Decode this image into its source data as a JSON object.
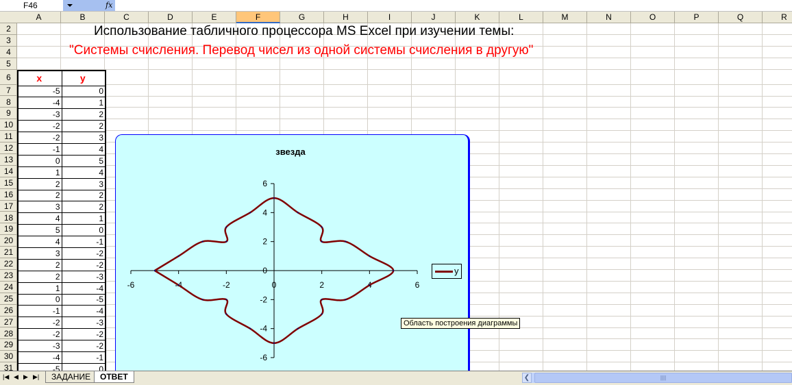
{
  "formula_bar": {
    "name_box": "F46",
    "fx_icon": "fx"
  },
  "columns": [
    "A",
    "B",
    "C",
    "D",
    "E",
    "F",
    "G",
    "H",
    "I",
    "J",
    "K",
    "L",
    "M",
    "N",
    "O",
    "P",
    "Q",
    "R"
  ],
  "selected_column": "F",
  "rows": [
    "2",
    "3",
    "4",
    "5",
    "6",
    "7",
    "8",
    "9",
    "10",
    "11",
    "12",
    "13",
    "14",
    "15",
    "16",
    "17",
    "18",
    "19",
    "20",
    "21",
    "22",
    "23",
    "24",
    "25",
    "26",
    "27",
    "28",
    "29",
    "30",
    "31"
  ],
  "heading_line1": "Использование табличного процессора MS Excel при изучении темы:",
  "heading_line2": "\"Системы счисления. Перевод чисел из одной системы счисления в другую\"",
  "heading_line2_color": "#ff0000",
  "table": {
    "headers": [
      "x",
      "y"
    ],
    "x": [
      -5,
      -4,
      -3,
      -2,
      -2,
      -1,
      0,
      1,
      2,
      2,
      3,
      4,
      5,
      4,
      3,
      2,
      2,
      1,
      0,
      -1,
      -2,
      -2,
      -3,
      -4,
      -5
    ],
    "y": [
      0,
      1,
      2,
      2,
      3,
      4,
      5,
      4,
      3,
      2,
      2,
      1,
      0,
      -1,
      -2,
      -2,
      -3,
      -4,
      -5,
      -4,
      -3,
      -2,
      -2,
      -1,
      0
    ]
  },
  "chart_data": {
    "type": "scatter",
    "title": "звезда",
    "series": [
      {
        "name": "y",
        "color": "#800000",
        "x": [
          -5,
          -4,
          -3,
          -2,
          -2,
          -1,
          0,
          1,
          2,
          2,
          3,
          4,
          5,
          4,
          3,
          2,
          2,
          1,
          0,
          -1,
          -2,
          -2,
          -3,
          -4,
          -5
        ],
        "y": [
          0,
          1,
          2,
          2,
          3,
          4,
          5,
          4,
          3,
          2,
          2,
          1,
          0,
          -1,
          -2,
          -2,
          -3,
          -4,
          -5,
          -4,
          -3,
          -2,
          -2,
          -1,
          0
        ]
      }
    ],
    "xlim": [
      -6,
      6
    ],
    "ylim": [
      -6,
      6
    ],
    "xticks": [
      "-6",
      "-4",
      "-2",
      "0",
      "2",
      "4",
      "6"
    ],
    "yticks": [
      "6",
      "4",
      "2",
      "0",
      "-2",
      "-4",
      "-6"
    ],
    "legend": "right",
    "smoothed": true
  },
  "tooltip": "Область построения диаграммы",
  "sheet_tabs": [
    {
      "label": "ЗАДАНИЕ",
      "active": false
    },
    {
      "label": "ОТВЕТ",
      "active": true
    }
  ]
}
